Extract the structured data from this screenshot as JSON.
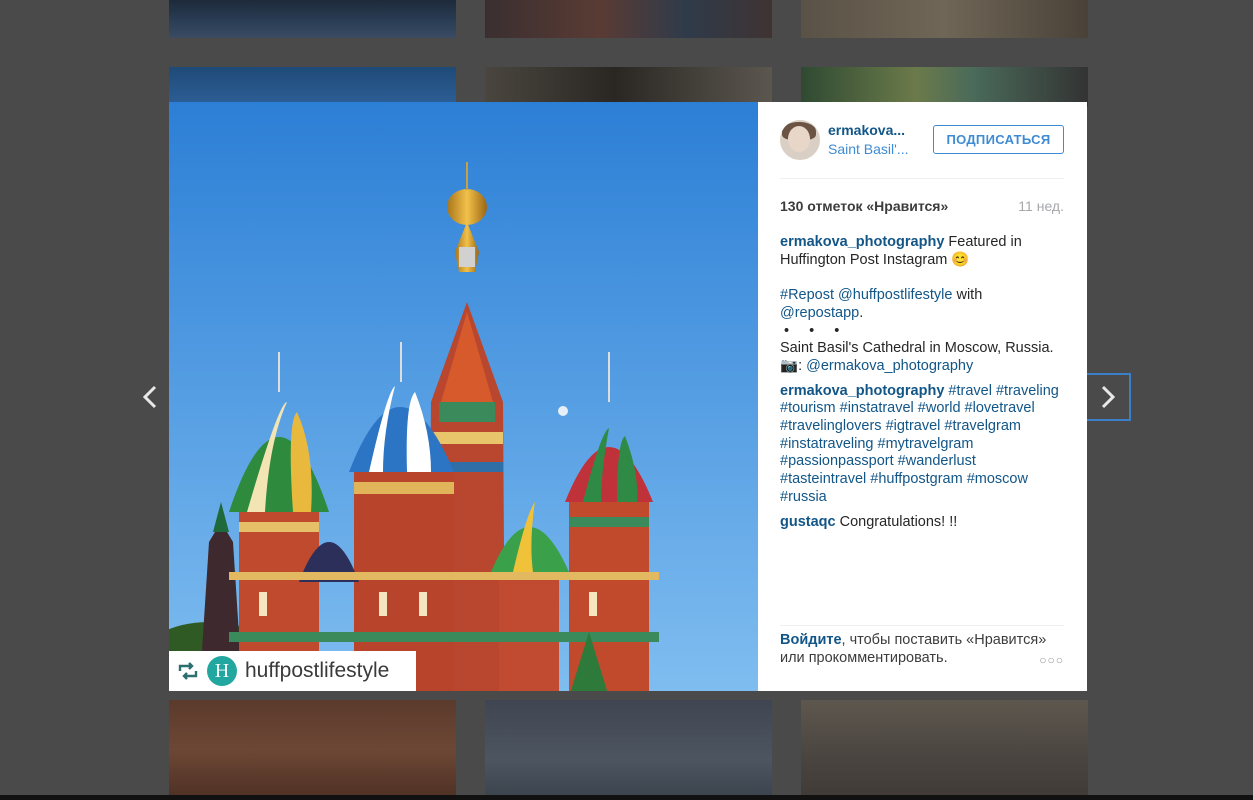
{
  "post": {
    "username": "ermakova...",
    "location": "Saint Basil'...",
    "follow_label": "ПОДПИСАТЬСЯ",
    "likes": "130 отметок «Нравится»",
    "age": "11 нед.",
    "caption_user": "ermakova_photography",
    "caption_text": " Featured in Huffington Post Instagram 😊",
    "repost_tag": "#Repost",
    "repost_handle": "@huffpostlifestyle",
    "with_text": " with",
    "repostapp": "@repostapp",
    "period": ".",
    "dots": "• • •",
    "description": "Saint Basil's Cathedral in Moscow, Russia.",
    "camera_glyph": "📷",
    "colon": ": ",
    "credit": "@ermakova_photography",
    "hashtags_user": "ermakova_photography",
    "hashtags": "#travel #traveling #tourism #instatravel #world #lovetravel #travelinglovers #igtravel #travelgram #instatraveling #mytravelgram #passionpassport #wanderlust #tasteintravel #huffpostgram #moscow #russia",
    "comment_user": "gustaqc",
    "comment_text": " Congratulations! !!",
    "login_link": "Войдите",
    "login_text": ", чтобы поставить «Нравится» или прокомментировать.",
    "more_label": "○○○"
  },
  "watermark": {
    "logo_letter": "H",
    "handle": "huffpostlifestyle"
  },
  "colors": {
    "link": "#125688",
    "accent": "#3f8bd3",
    "overlay": "#4a4a4a"
  }
}
